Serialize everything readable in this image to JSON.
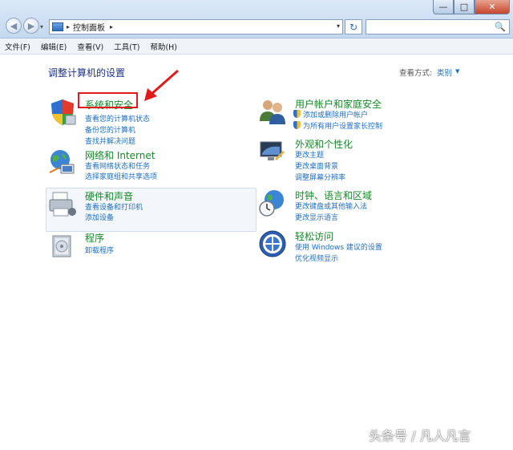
{
  "window": {
    "minimize_glyph": "—",
    "maximize_glyph": "□",
    "close_glyph": "✕"
  },
  "nav": {
    "back_glyph": "◀",
    "forward_glyph": "▶",
    "history_glyph": "▾"
  },
  "address": {
    "breadcrumb_sep": "▸",
    "path": "控制面板",
    "dropdown_glyph": "▾",
    "refresh_glyph": "↻"
  },
  "search": {
    "value": "",
    "icon_glyph": "🔍"
  },
  "menu": [
    "文件(F)",
    "编辑(E)",
    "查看(V)",
    "工具(T)",
    "帮助(H)"
  ],
  "page": {
    "title": "调整计算机的设置",
    "view_by_label": "查看方式:",
    "view_by_value": "类别",
    "view_by_arrow": "▼"
  },
  "categories": {
    "system_security": {
      "title": "系统和安全",
      "links": [
        "查看您的计算机状态",
        "备份您的计算机",
        "查找并解决问题"
      ]
    },
    "network": {
      "title": "网络和 Internet",
      "links": [
        "查看网络状态和任务",
        "选择家庭组和共享选项"
      ]
    },
    "hardware": {
      "title": "硬件和声音",
      "links": [
        "查看设备和打印机",
        "添加设备"
      ]
    },
    "programs": {
      "title": "程序",
      "links": [
        "卸载程序"
      ]
    },
    "user_accounts": {
      "title": "用户帐户和家庭安全",
      "links": [
        "添加或删除用户帐户",
        "为所有用户设置家长控制"
      ]
    },
    "appearance": {
      "title": "外观和个性化",
      "links": [
        "更改主题",
        "更改桌面背景",
        "调整屏幕分辨率"
      ]
    },
    "clock_region": {
      "title": "时钟、语言和区域",
      "links": [
        "更改键盘或其他输入法",
        "更改显示语言"
      ]
    },
    "ease_access": {
      "title": "轻松访问",
      "links": [
        "使用 Windows 建议的设置",
        "优化视频显示"
      ]
    }
  },
  "annotation": {
    "color": "#e21a1a"
  },
  "watermark": "头条号 / 凡人凡言",
  "colors": {
    "category_title": "#138a27",
    "link": "#1f6fc5",
    "page_title": "#1e3287"
  }
}
